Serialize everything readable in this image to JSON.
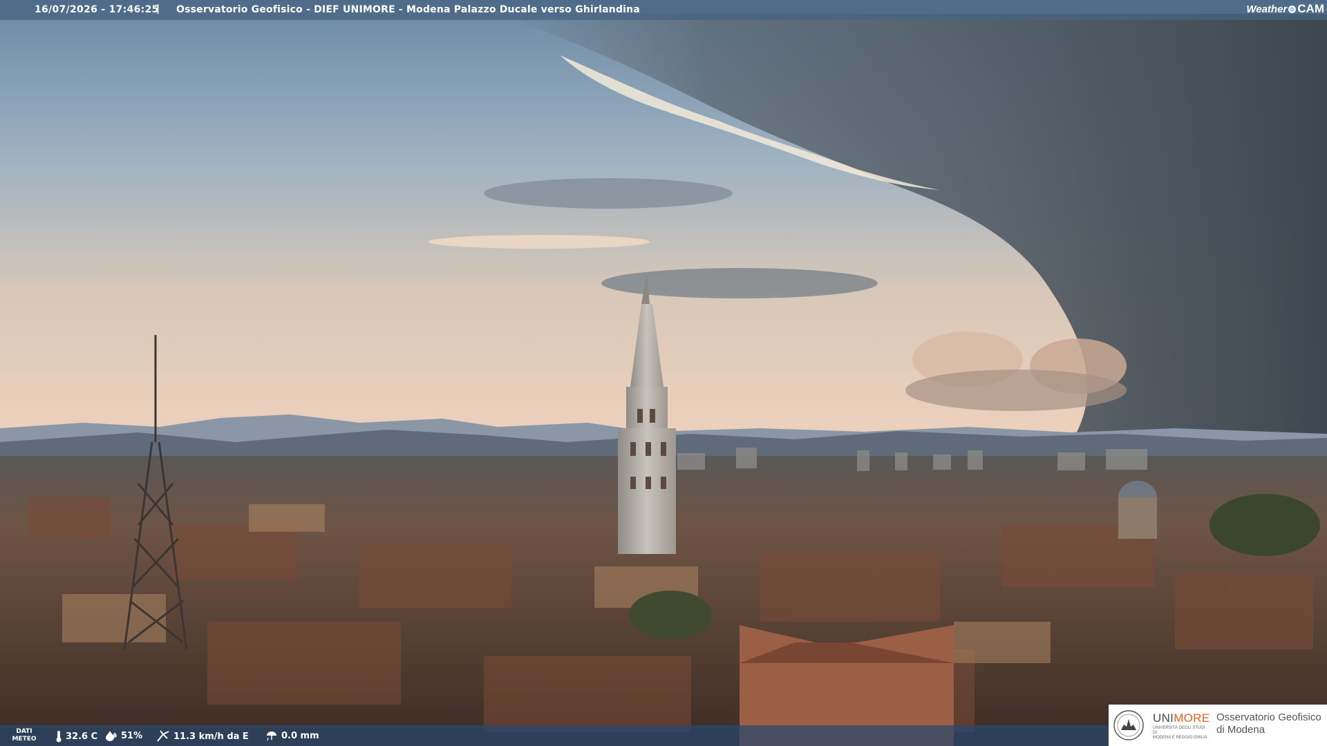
{
  "header": {
    "datetime": "16/07/2026 - 17:46:25",
    "separator": "|",
    "title": "Osservatorio Geofisico - DIEF UNIMORE - Modena Palazzo Ducale verso Ghirlandina",
    "brand_weather": "Weather",
    "brand_cam": "CAM"
  },
  "footer": {
    "dati_label_1": "DATI",
    "dati_label_2": "METEO",
    "temperature": "32.6 C",
    "humidity": "51%",
    "wind": "11.3 km/h da E",
    "rain": "0.0 mm",
    "icons": [
      "thermometer-icon",
      "humidity-drop-icon",
      "wind-icon",
      "rain-icon"
    ]
  },
  "logo": {
    "uni_prefix": "UNI",
    "uni_suffix": "MORE",
    "university_line1": "UNIVERSITÀ DEGLI STUDI DI",
    "university_line2": "MODENA E REGGIO EMILIA",
    "observatory_line1": "Osservatorio Geofisico",
    "observatory_line2": "di Modena"
  },
  "colors": {
    "accent_orange": "#e0642a",
    "bar_blue": "#46648c"
  }
}
